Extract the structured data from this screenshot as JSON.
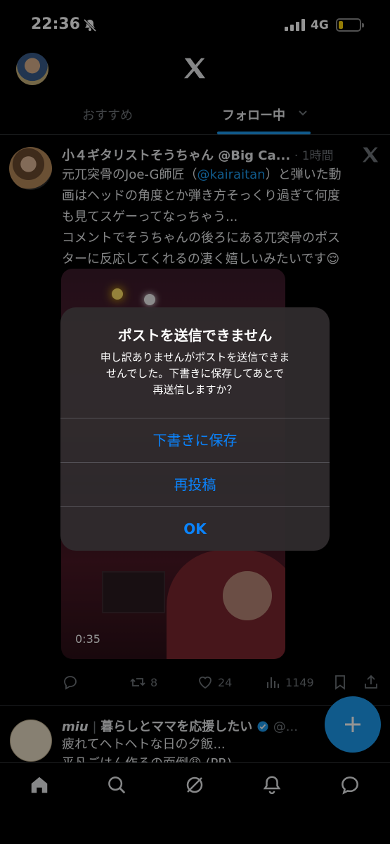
{
  "status_bar": {
    "time": "22:36",
    "network": "4G",
    "battery_level": 0.2,
    "battery_color": "#ffd60a"
  },
  "header": {
    "logo_icon": "x-logo-icon",
    "tabs": [
      {
        "label": "おすすめ",
        "active": false
      },
      {
        "label": "フォロー中",
        "active": true
      }
    ],
    "accent_color": "#1d9bf0"
  },
  "post": {
    "author": "小４ギタリストそうちゃん @Big Ca...",
    "time": "· 1時間",
    "body_line1": "元兀突骨のJoe-G師匠（",
    "mention": "@kairaitan",
    "body_line1_end": "）と弾いた動",
    "body_line2": "画はヘッドの角度とか弾き方そっくり過ぎて何度",
    "body_line3": "も見てスゲーってなっちゃう...",
    "body_line4": "コメントでそうちゃんの後ろにある兀突骨のポス",
    "body_line5": "ターに反応してくれるの凄く嬉しいみたいです😌",
    "video_duration": "0:35",
    "stats": {
      "reposts": "8",
      "likes": "24",
      "views": "1149"
    }
  },
  "post2": {
    "author": "miu",
    "separator": "|",
    "bio": "暮らしとママを応援したい",
    "handle": "@...",
    "body_line1": "疲れてヘトヘトな日の夕飯...",
    "body_line2": "平凡ごはん作るの面倒😩 (PR)"
  },
  "alert": {
    "title": "ポストを送信できません",
    "message_line1": "申し訳ありませんがポストを送信できま",
    "message_line2": "せんでした。下書きに保存してあとで",
    "message_line3": "再送信しますか？",
    "buttons": [
      "下書きに保存",
      "再投稿",
      "OK"
    ],
    "button_color": "#0a84ff"
  }
}
